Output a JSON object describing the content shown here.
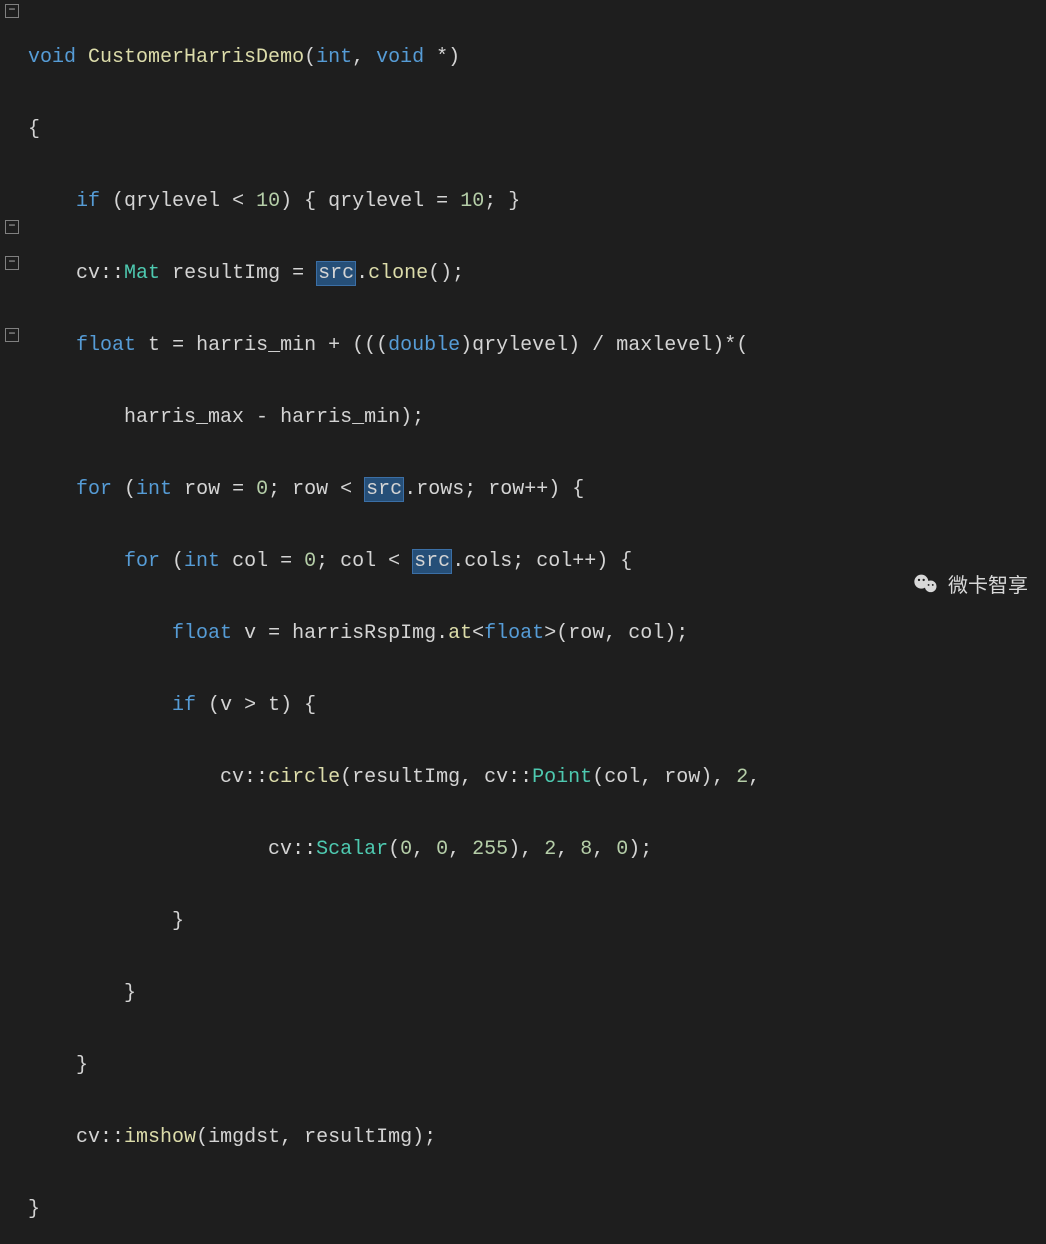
{
  "code": {
    "l1_kw_void": "void",
    "l1_func": "CustomerHarrisDemo",
    "l1_param_int": "int",
    "l1_param_void": "void",
    "l1_ptr": " *",
    "l2_brace": "{",
    "l3_if": "if",
    "l3_var1": "qrylevel",
    "l3_lt": "<",
    "l3_ten": "10",
    "l3_eq": "=",
    "l4_cv": "cv",
    "l4_colcol": "::",
    "l4_Mat": "Mat",
    "l4_resultImg": "resultImg",
    "l4_src": "src",
    "l4_clone": "clone",
    "l5_float": "float",
    "l5_t": "t",
    "l5_hmin": "harris_min",
    "l5_double": "double",
    "l5_qry": "qrylevel",
    "l5_maxlevel": "maxlevel",
    "l6_hmax": "harris_max",
    "l6_hmin": "harris_min",
    "l7_for": "for",
    "l7_int": "int",
    "l7_row": "row",
    "l7_zero": "0",
    "l7_src": "src",
    "l7_rows": "rows",
    "l8_col": "col",
    "l8_cols": "cols",
    "l9_float": "float",
    "l9_v": "v",
    "l9_harrisRsp": "harrisRspImg",
    "l9_at": "at",
    "l9_floatT": "float",
    "l9_row": "row",
    "l9_col": "col",
    "l10_if": "if",
    "l10_v": "v",
    "l10_t": "t",
    "l11_cv": "cv",
    "l11_circle": "circle",
    "l11_resultImg": "resultImg",
    "l11_Point": "Point",
    "l11_col": "col",
    "l11_row": "row",
    "l11_two": "2",
    "l12_cv": "cv",
    "l12_Scalar": "Scalar",
    "l12_z": "0",
    "l12_255": "255",
    "l12_two": "2",
    "l12_eight": "8",
    "l15_imshow": "imshow",
    "l15_imgdst": "imgdst",
    "l15_resultImg": "resultImg"
  },
  "watermark": {
    "text": "微卡智享"
  }
}
